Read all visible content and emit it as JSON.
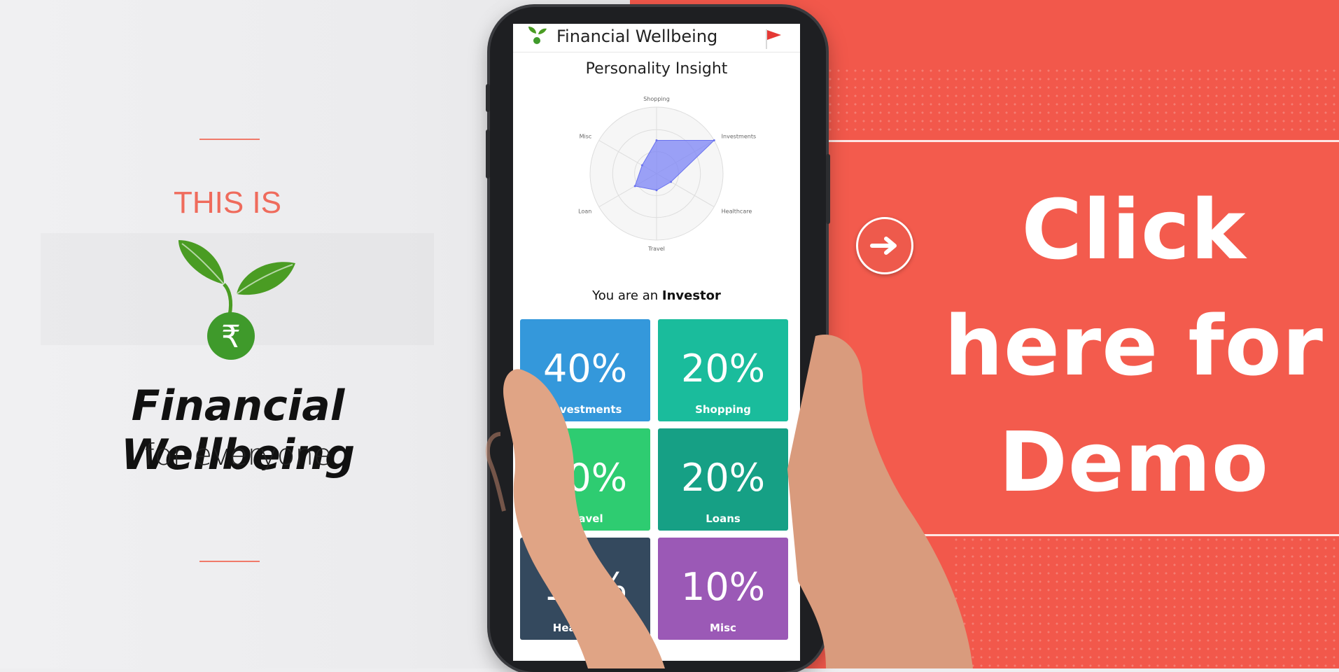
{
  "left": {
    "tagline_top": "THIS IS",
    "brand_name": "Financial Wellbeing",
    "brand_sub": "for everyone",
    "logo_symbol": "₹",
    "icon": "sprout-rupee-logo-icon"
  },
  "phone": {
    "app_title": "Financial Wellbeing",
    "header_icon": "sprout-icon",
    "flag_icon": "red-flag-icon",
    "section_title": "Personality Insight",
    "personality_prefix": "You are an",
    "personality_type": "Investor",
    "tiles": [
      {
        "value": "40%",
        "label": "Investments",
        "color": "#3498db"
      },
      {
        "value": "20%",
        "label": "Shopping",
        "color": "#1abc9c"
      },
      {
        "value": "10%",
        "label": "Travel",
        "color": "#2ecc71"
      },
      {
        "value": "20%",
        "label": "Loans",
        "color": "#16a085"
      },
      {
        "value": "15%",
        "label": "Healthcare",
        "color": "#34495e"
      },
      {
        "value": "10%",
        "label": "Misc",
        "color": "#9b59b6"
      }
    ]
  },
  "chart_data": {
    "type": "radar",
    "categories": [
      "Shopping",
      "Investments",
      "Healthcare",
      "Travel",
      "Loan",
      "Misc"
    ],
    "values": [
      20,
      40,
      10,
      10,
      15,
      10
    ],
    "rmax": 40,
    "fill_color": "#7b83f5"
  },
  "demo": {
    "line1": "Click",
    "line2": "here for",
    "line3": "Demo",
    "arrow_icon": "arrow-right-circle-icon",
    "accent": "#f2584b"
  }
}
